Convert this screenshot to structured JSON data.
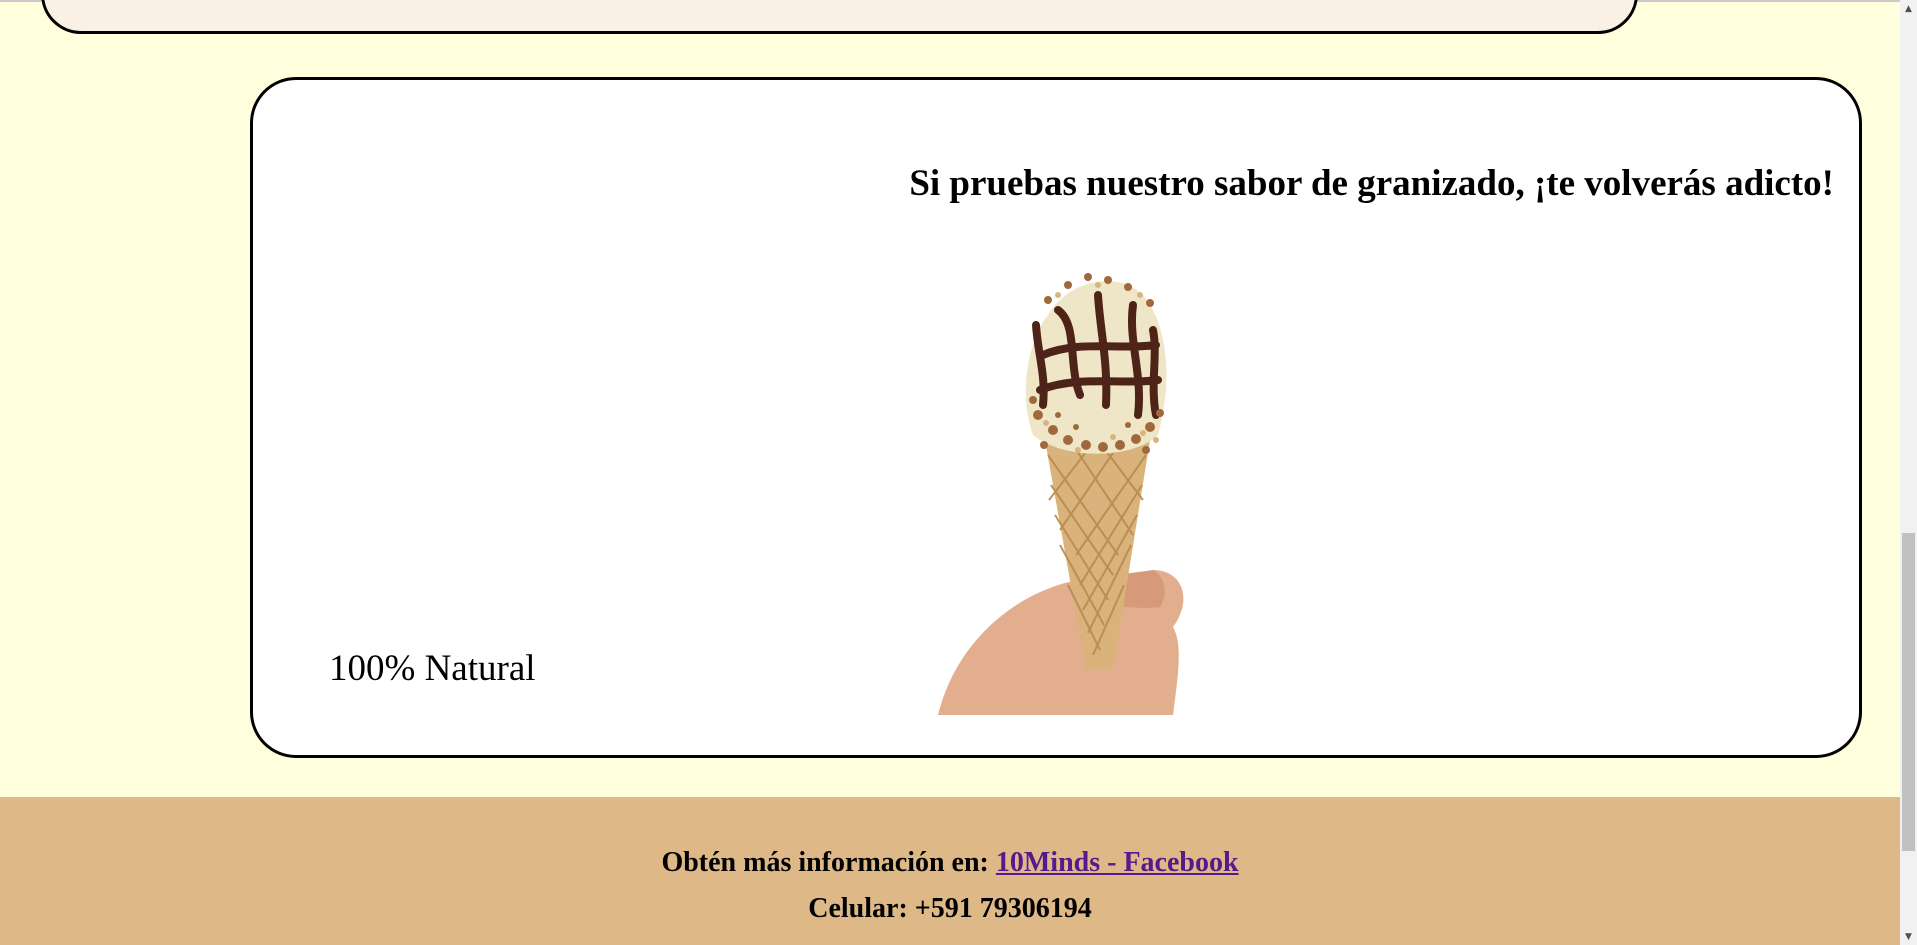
{
  "card": {
    "heading": "Si pruebas nuestro sabor de granizado, ¡te volverás adicto!",
    "image_alt": "Helado de cono con chocolate y nueces",
    "caption": "100% Natural"
  },
  "footer": {
    "info_label": "Obtén más información en: ",
    "link_text": "10Minds - Facebook",
    "phone_text": "Celular: +591 79306194"
  },
  "colors": {
    "page_background": "#ffffde",
    "previous_card_background": "#faf0e6",
    "card_background": "#ffffff",
    "footer_background": "#deb887",
    "link_color": "#551a8b"
  },
  "scrollbar": {
    "up_icon": "scroll-up-arrow-icon",
    "down_icon": "scroll-down-arrow-icon"
  }
}
